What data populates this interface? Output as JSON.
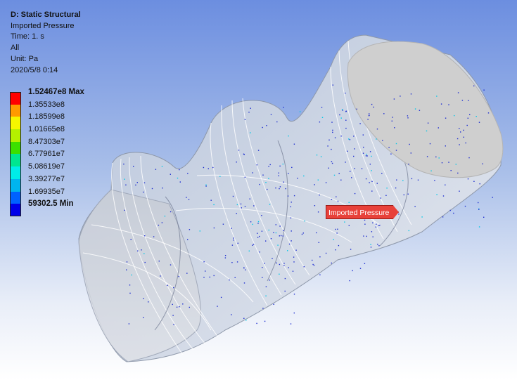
{
  "info": {
    "title": "D: Static Structural",
    "result": "Imported Pressure",
    "time": "Time: 1. s",
    "scope": "All",
    "unit": "Unit: Pa",
    "timestamp": "2020/5/8 0:14"
  },
  "legend": [
    {
      "label": "1.52467e8 Max",
      "color": "#ff0000",
      "bold": true
    },
    {
      "label": "1.35533e8",
      "color": "#ff9a00",
      "bold": false
    },
    {
      "label": "1.18599e8",
      "color": "#f6f600",
      "bold": false
    },
    {
      "label": "1.01665e8",
      "color": "#b4f000",
      "bold": false
    },
    {
      "label": "8.47303e7",
      "color": "#3ce000",
      "bold": false
    },
    {
      "label": "6.77961e7",
      "color": "#00e690",
      "bold": false
    },
    {
      "label": "5.08619e7",
      "color": "#00ede8",
      "bold": false
    },
    {
      "label": "3.39277e7",
      "color": "#00b4ee",
      "bold": false
    },
    {
      "label": "1.69935e7",
      "color": "#0062ff",
      "bold": false
    },
    {
      "label": "59302.5 Min",
      "color": "#0000e8",
      "bold": true
    }
  ],
  "callout": {
    "label": "Imported Pressure",
    "color": "#e8413a"
  },
  "colors": {
    "body_fill": "#c9d2e1",
    "cap_fill": "#cfcfcf",
    "dot": "#1f2fd0"
  }
}
